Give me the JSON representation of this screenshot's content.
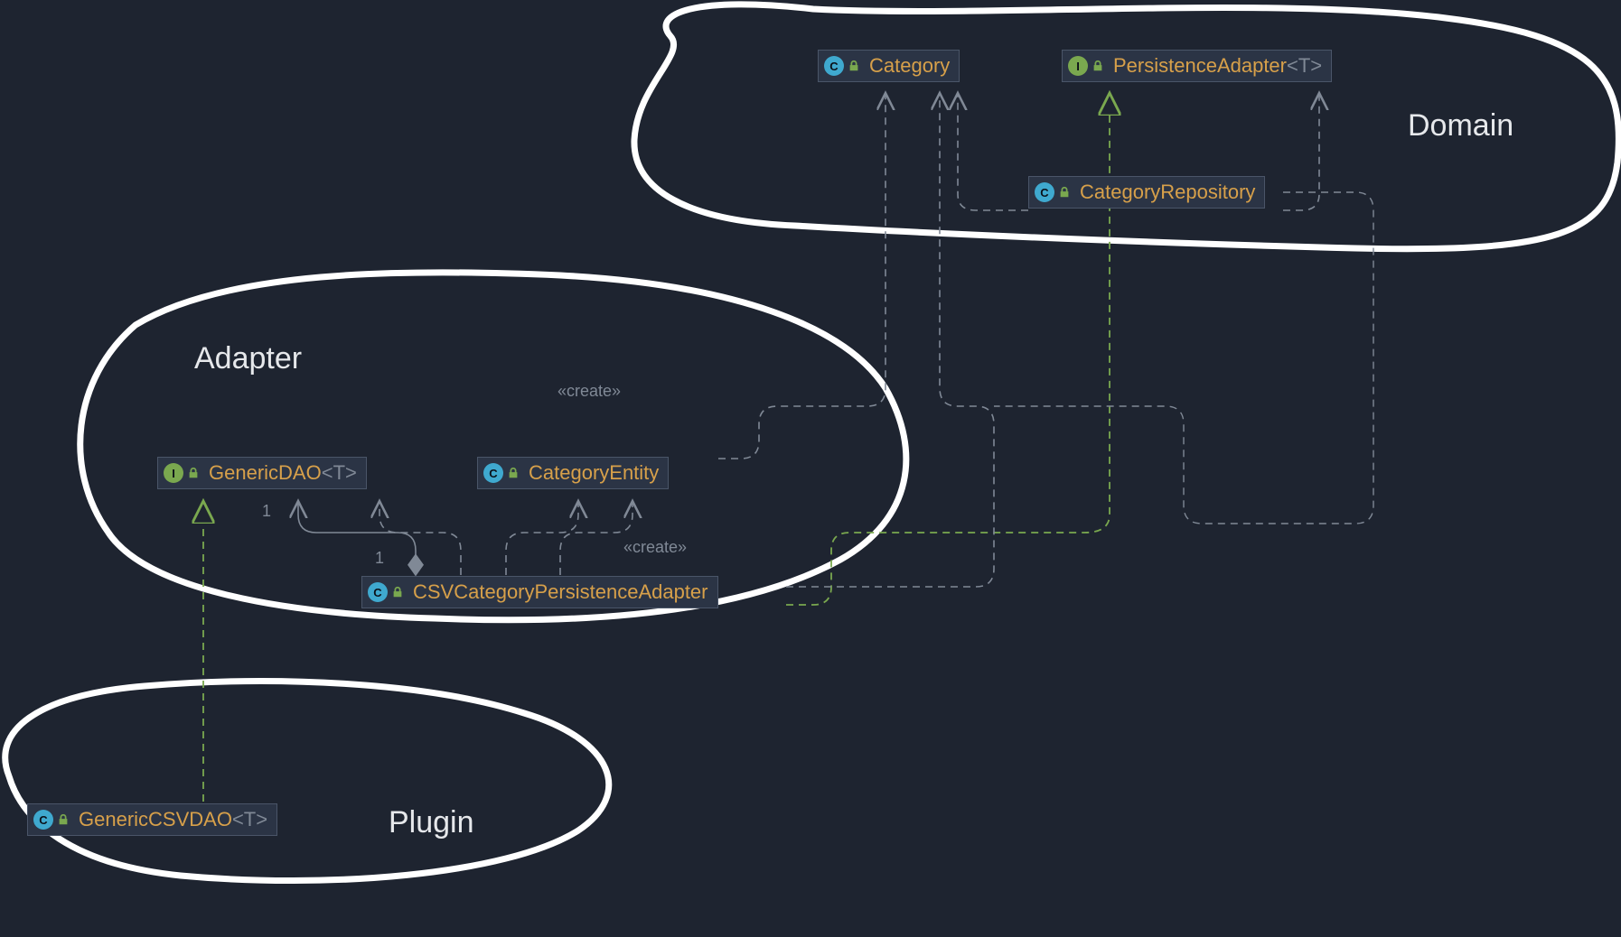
{
  "regions": {
    "domain": "Domain",
    "adapter": "Adapter",
    "plugin": "Plugin"
  },
  "nodes": {
    "category": {
      "kind": "C",
      "name": "Category",
      "generic": ""
    },
    "persistenceAdapter": {
      "kind": "I",
      "name": "PersistenceAdapter",
      "generic": "<T>"
    },
    "categoryRepository": {
      "kind": "C",
      "name": "CategoryRepository",
      "generic": ""
    },
    "genericDAO": {
      "kind": "I",
      "name": "GenericDAO",
      "generic": "<T>"
    },
    "categoryEntity": {
      "kind": "C",
      "name": "CategoryEntity",
      "generic": ""
    },
    "csvCatPersistAdapter": {
      "kind": "C",
      "name": "CSVCategoryPersistenceAdapter",
      "generic": ""
    },
    "genericCSVDAO": {
      "kind": "C",
      "name": "GenericCSVDAO",
      "generic": "<T>"
    }
  },
  "edgeLabels": {
    "create1": "«create»",
    "create2": "«create»"
  },
  "multiplicities": {
    "m1": "1",
    "m2": "1"
  },
  "chart_data": {
    "type": "uml-class-diagram",
    "groups": [
      {
        "name": "Domain",
        "members": [
          "Category",
          "PersistenceAdapter<T>",
          "CategoryRepository"
        ]
      },
      {
        "name": "Adapter",
        "members": [
          "GenericDAO<T>",
          "CategoryEntity",
          "CSVCategoryPersistenceAdapter"
        ]
      },
      {
        "name": "Plugin",
        "members": [
          "GenericCSVDAO<T>"
        ]
      }
    ],
    "classes": [
      {
        "name": "Category",
        "stereotype": "class"
      },
      {
        "name": "PersistenceAdapter<T>",
        "stereotype": "interface"
      },
      {
        "name": "CategoryRepository",
        "stereotype": "class"
      },
      {
        "name": "GenericDAO<T>",
        "stereotype": "interface"
      },
      {
        "name": "CategoryEntity",
        "stereotype": "class"
      },
      {
        "name": "CSVCategoryPersistenceAdapter",
        "stereotype": "class"
      },
      {
        "name": "GenericCSVDAO<T>",
        "stereotype": "class"
      }
    ],
    "relationships": [
      {
        "from": "CategoryRepository",
        "to": "Category",
        "type": "dependency"
      },
      {
        "from": "CategoryRepository",
        "to": "PersistenceAdapter<T>",
        "type": "dependency"
      },
      {
        "from": "CategoryEntity",
        "to": "Category",
        "type": "dependency",
        "label": "«create»"
      },
      {
        "from": "CSVCategoryPersistenceAdapter",
        "to": "Category",
        "type": "dependency"
      },
      {
        "from": "CSVCategoryPersistenceAdapter",
        "to": "PersistenceAdapter<T>",
        "type": "realization"
      },
      {
        "from": "CSVCategoryPersistenceAdapter",
        "to": "GenericDAO<T>",
        "type": "aggregation",
        "fromMultiplicity": "1",
        "toMultiplicity": "1"
      },
      {
        "from": "CSVCategoryPersistenceAdapter",
        "to": "CategoryEntity",
        "type": "dependency",
        "label": "«create»"
      },
      {
        "from": "CSVCategoryPersistenceAdapter",
        "to": "CategoryEntity",
        "type": "dependency"
      },
      {
        "from": "GenericCSVDAO<T>",
        "to": "GenericDAO<T>",
        "type": "realization"
      }
    ]
  }
}
